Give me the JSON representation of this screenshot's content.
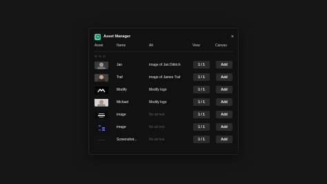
{
  "dialog": {
    "title": "Asset Manager",
    "close_label": "×",
    "brand_color": "#3ed3a8"
  },
  "columns": {
    "asset": "Asset",
    "name": "Name",
    "alt": "Alt",
    "view": "View",
    "canvas": "Canvas"
  },
  "rows": [
    {
      "name": "Jan",
      "alt": "image of Jan Dittrich",
      "alt_placeholder": false,
      "view": "1 / 1",
      "add": "Add",
      "thumb": "photo-dark"
    },
    {
      "name": "Traf",
      "alt": "image of James Traf",
      "alt_placeholder": false,
      "view": "1 / 1",
      "add": "Add",
      "thumb": "photo-warm"
    },
    {
      "name": "Modify",
      "alt": "Modify logo",
      "alt_placeholder": false,
      "view": "1 / 1",
      "add": "Add",
      "thumb": "logo"
    },
    {
      "name": "Michael",
      "alt": "Modify logo",
      "alt_placeholder": false,
      "view": "1 / 1",
      "add": "Add",
      "thumb": "photo-light"
    },
    {
      "name": "image",
      "alt": "No alt text",
      "alt_placeholder": true,
      "view": "1 / 1",
      "add": "Add",
      "thumb": "dark-text"
    },
    {
      "name": "image",
      "alt": "No alt text",
      "alt_placeholder": true,
      "view": "1 / 1",
      "add": "Add",
      "thumb": "dark-blocks"
    },
    {
      "name": "Screenshot...",
      "alt": "No alt text",
      "alt_placeholder": true,
      "view": "1 / 1",
      "add": "Add",
      "thumb": "dark-screenshot"
    }
  ]
}
